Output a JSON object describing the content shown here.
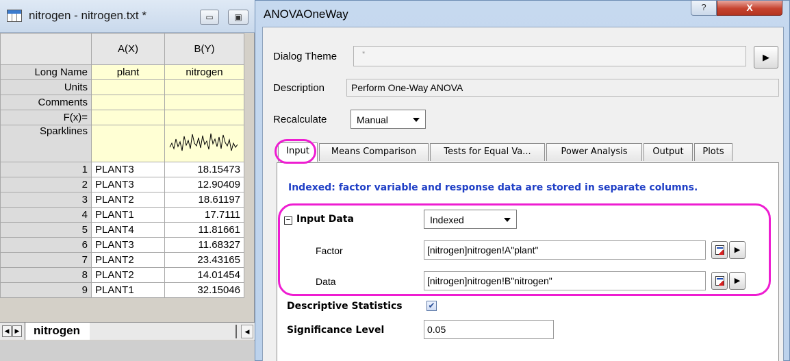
{
  "worksheet": {
    "title": "nitrogen - nitrogen.txt *",
    "minimize_icon": "minimize-icon",
    "restore_icon": "restore-icon",
    "columns": [
      "A(X)",
      "B(Y)"
    ],
    "meta_rows": [
      {
        "label": "Long Name",
        "a": "plant",
        "b": "nitrogen"
      },
      {
        "label": "Units",
        "a": "",
        "b": ""
      },
      {
        "label": "Comments",
        "a": "",
        "b": ""
      },
      {
        "label": "F(x)=",
        "a": "",
        "b": ""
      }
    ],
    "sparklines_label": "Sparklines",
    "rows": [
      {
        "n": "1",
        "a": "PLANT3",
        "b": "18.15473"
      },
      {
        "n": "2",
        "a": "PLANT3",
        "b": "12.90409"
      },
      {
        "n": "3",
        "a": "PLANT2",
        "b": "18.61197"
      },
      {
        "n": "4",
        "a": "PLANT1",
        "b": "17.7111"
      },
      {
        "n": "5",
        "a": "PLANT4",
        "b": "11.81661"
      },
      {
        "n": "6",
        "a": "PLANT3",
        "b": "11.68327"
      },
      {
        "n": "7",
        "a": "PLANT2",
        "b": "23.43165"
      },
      {
        "n": "8",
        "a": "PLANT2",
        "b": "14.01454"
      },
      {
        "n": "9",
        "a": "PLANT1",
        "b": "32.15046"
      }
    ],
    "sheet_tab": "nitrogen"
  },
  "dialog": {
    "title": "ANOVAOneWay",
    "help_glyph": "?",
    "close_glyph": "X",
    "dialog_theme_label": "Dialog Theme",
    "dialog_theme_value": "*",
    "description_label": "Description",
    "description_value": "Perform One-Way ANOVA",
    "recalculate_label": "Recalculate",
    "recalculate_value": "Manual",
    "tabs": [
      "Input",
      "Means Comparison",
      "Tests for Equal Va...",
      "Power Analysis",
      "Output",
      "Plots"
    ],
    "active_tab": "Input",
    "info": "Indexed: factor variable and response data are stored in separate columns.",
    "input_data_label": "Input Data",
    "input_data_toggle": "−",
    "input_data_value": "Indexed",
    "factor_label": "Factor",
    "factor_value": "[nitrogen]nitrogen!A\"plant\"",
    "data_label": "Data",
    "data_value": "[nitrogen]nitrogen!B\"nitrogen\"",
    "descriptive_label": "Descriptive Statistics",
    "descriptive_checked": true,
    "significance_label": "Significance Level",
    "significance_value": "0.05"
  },
  "colors": {
    "highlight": "#ee1dd1",
    "info_text": "#1f3fc6",
    "meta_cells": "#ffffd4"
  }
}
